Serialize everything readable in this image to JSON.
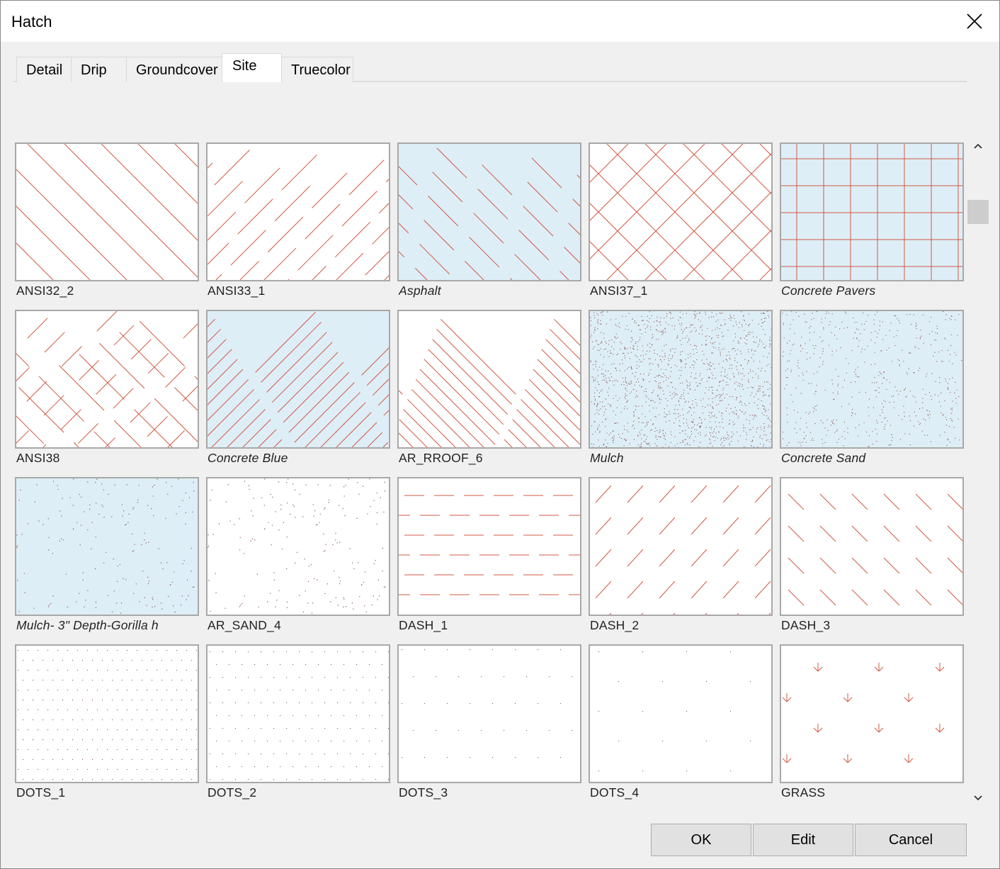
{
  "window": {
    "title": "Hatch"
  },
  "tabs": [
    {
      "label": "Detail",
      "active": false
    },
    {
      "label": "Drip",
      "active": false
    },
    {
      "label": "Groundcover",
      "active": false
    },
    {
      "label": "Site",
      "active": true
    },
    {
      "label": "Truecolor",
      "active": false
    }
  ],
  "colors": {
    "hatch_line": "#d05a43",
    "tint_blue": "#deeef7",
    "thumb_border": "#a8a8a8"
  },
  "hatches": [
    {
      "name": "ANSI32_2",
      "italic": false,
      "bg": "white",
      "pattern": "diag-down-sparse"
    },
    {
      "name": "ANSI33_1",
      "italic": false,
      "bg": "white",
      "pattern": "diag-up-dashed"
    },
    {
      "name": "Asphalt",
      "italic": true,
      "bg": "blue",
      "pattern": "diag-down-dashed"
    },
    {
      "name": "ANSI37_1",
      "italic": false,
      "bg": "white",
      "pattern": "crosshatch"
    },
    {
      "name": "Concrete Pavers",
      "italic": true,
      "bg": "blue",
      "pattern": "grid"
    },
    {
      "name": "ANSI38",
      "italic": false,
      "bg": "white",
      "pattern": "crosshatch-broken"
    },
    {
      "name": "Concrete Blue",
      "italic": true,
      "bg": "blue",
      "pattern": "diag-up-dense"
    },
    {
      "name": "AR_RROOF_6",
      "italic": false,
      "bg": "white",
      "pattern": "diag-down-dense"
    },
    {
      "name": "Mulch",
      "italic": true,
      "bg": "blue",
      "pattern": "dots-dense"
    },
    {
      "name": "Concrete Sand",
      "italic": true,
      "bg": "blue",
      "pattern": "dots-medium"
    },
    {
      "name": "Mulch- 3\" Depth-Gorilla h",
      "italic": true,
      "bg": "blue",
      "pattern": "dots-sparse"
    },
    {
      "name": "AR_SAND_4",
      "italic": false,
      "bg": "white",
      "pattern": "dots-sparse"
    },
    {
      "name": "DASH_1",
      "italic": false,
      "bg": "white",
      "pattern": "dash-horizontal"
    },
    {
      "name": "DASH_2",
      "italic": false,
      "bg": "white",
      "pattern": "dash-up"
    },
    {
      "name": "DASH_3",
      "italic": false,
      "bg": "white",
      "pattern": "dash-down"
    },
    {
      "name": "DOTS_1",
      "italic": false,
      "bg": "white",
      "pattern": "dots-grid-fine"
    },
    {
      "name": "DOTS_2",
      "italic": false,
      "bg": "white",
      "pattern": "dots-grid-offset"
    },
    {
      "name": "DOTS_3",
      "italic": false,
      "bg": "white",
      "pattern": "dots-grid-wide"
    },
    {
      "name": "DOTS_4",
      "italic": false,
      "bg": "white",
      "pattern": "dots-grid-wider"
    },
    {
      "name": "GRASS",
      "italic": false,
      "bg": "white",
      "pattern": "grass"
    }
  ],
  "buttons": {
    "ok": "OK",
    "edit": "Edit",
    "cancel": "Cancel"
  },
  "icons": {
    "close": "close-icon",
    "scroll_up": "chevron-up-icon",
    "scroll_down": "chevron-down-icon"
  }
}
